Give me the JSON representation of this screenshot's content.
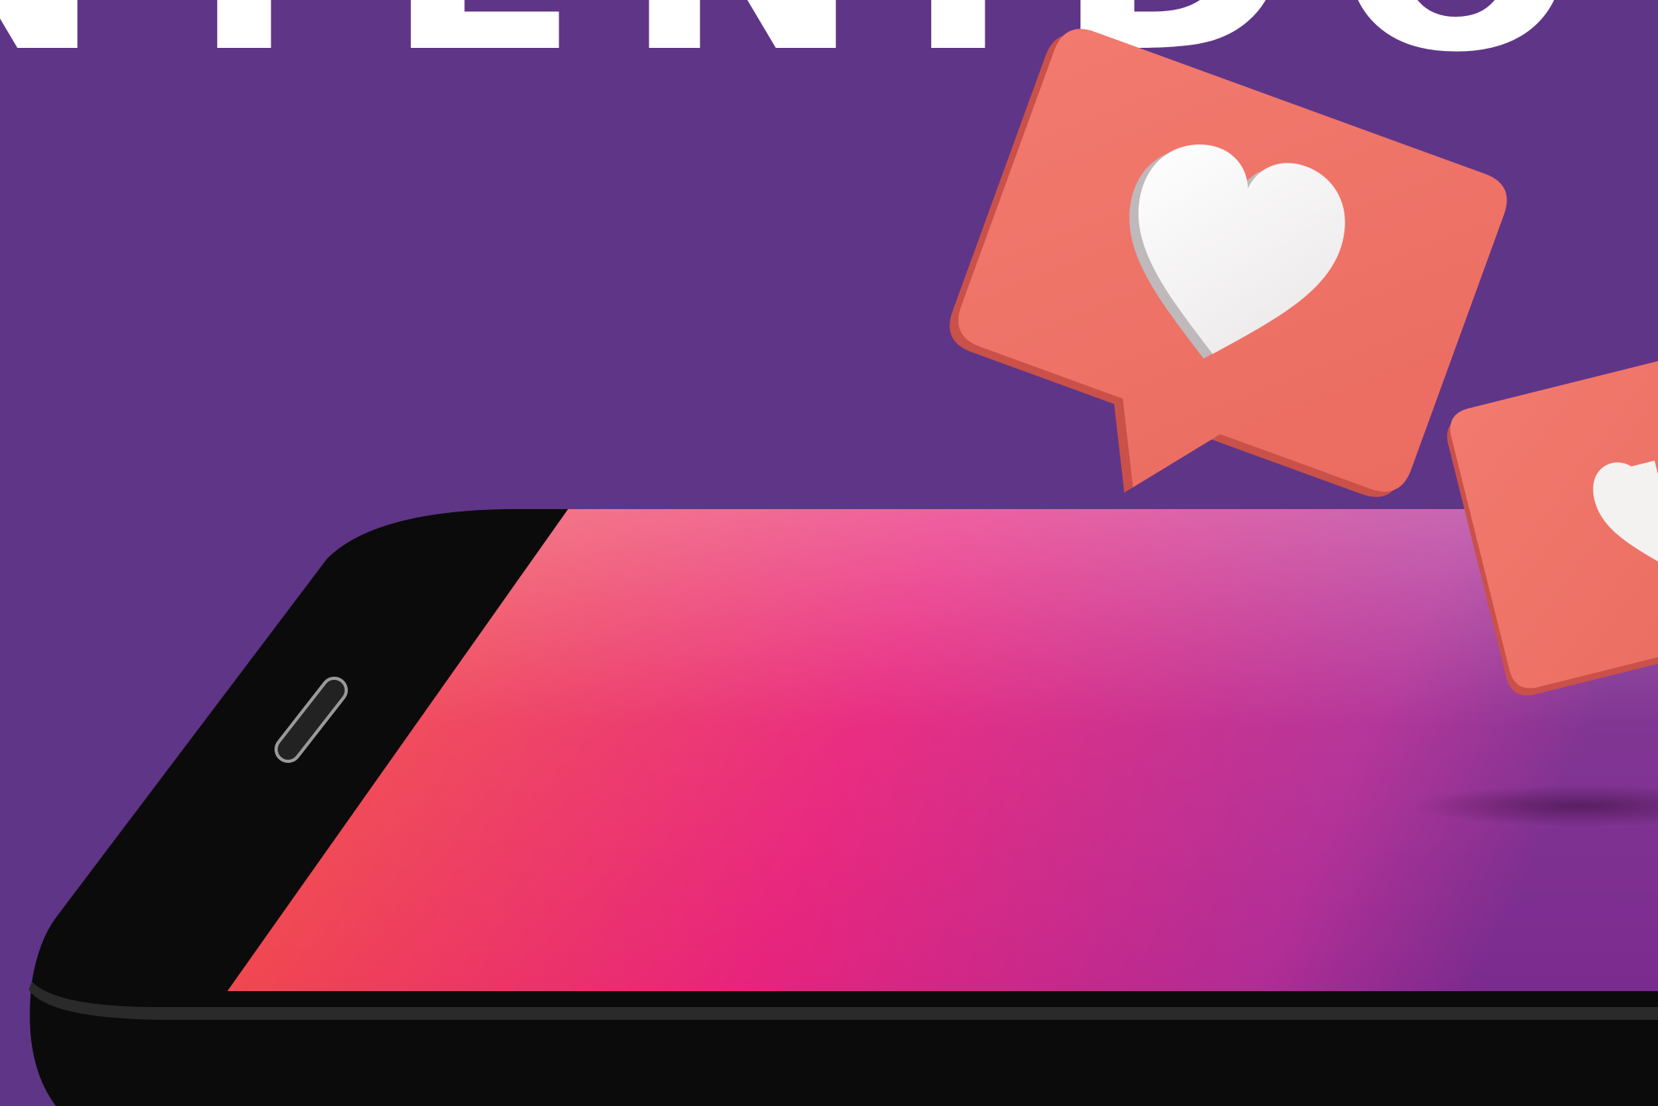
{
  "banner": {
    "title": "NTENIDO D"
  },
  "colors": {
    "background": "#5f3587",
    "title": "#ffffff",
    "phone_body": "#0b0b0b",
    "screen_start": "#f4573d",
    "screen_mid": "#e8237c",
    "screen_end": "#a12a90",
    "bubble": "#ef7268",
    "heart": "#f4f2f1"
  },
  "icons": {
    "phone": "smartphone",
    "speaker": "earpiece-speaker",
    "bubble_1": "like-bubble-heart",
    "bubble_2": "like-bubble-heart"
  }
}
